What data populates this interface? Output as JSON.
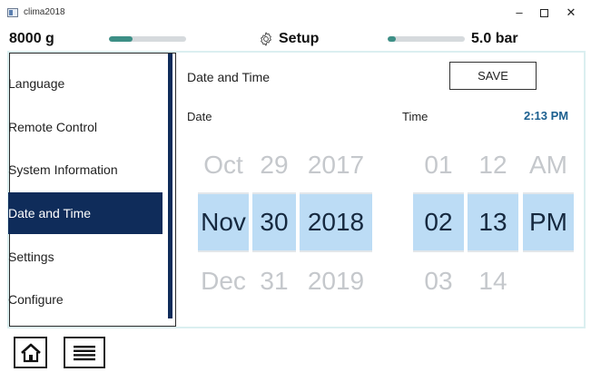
{
  "window": {
    "title": "clima2018",
    "min_glyph": "–",
    "close_glyph": "✕",
    "icons": {
      "app": "app-window-icon",
      "maximize": "maximize-icon"
    }
  },
  "status": {
    "weight": "8000 g",
    "weight_level": 0.3,
    "setup_label": "Setup",
    "setup_icon": "gear-icon",
    "pressure": "5.0 bar",
    "pressure_level": 0.1,
    "accent_color": "#3d8f86"
  },
  "sidebar": {
    "items": [
      {
        "label": "Language",
        "active": false
      },
      {
        "label": "Remote Control",
        "active": false
      },
      {
        "label": "System Information",
        "active": false
      },
      {
        "label": "Date and Time",
        "active": true
      },
      {
        "label": "Settings",
        "active": false
      },
      {
        "label": "Configure",
        "active": false
      }
    ],
    "active_color": "#0f2c5a"
  },
  "main": {
    "title": "Date and Time",
    "save_label": "SAVE",
    "date_label": "Date",
    "time_label": "Time",
    "current_time": "2:13 PM",
    "date_picker": {
      "month": {
        "prev": "Oct",
        "selected": "Nov",
        "next": "Dec"
      },
      "day": {
        "prev": "29",
        "selected": "30",
        "next": "31"
      },
      "year": {
        "prev": "2017",
        "selected": "2018",
        "next": "2019"
      }
    },
    "time_picker": {
      "hour": {
        "prev": "01",
        "selected": "02",
        "next": "03"
      },
      "minute": {
        "prev": "12",
        "selected": "13",
        "next": "14"
      },
      "ampm": {
        "prev": "AM",
        "selected": "PM",
        "next": ""
      }
    },
    "selected_color": "#bcdcf5"
  },
  "toolbar": {
    "home_icon": "home-icon",
    "menu_icon": "menu-icon"
  }
}
